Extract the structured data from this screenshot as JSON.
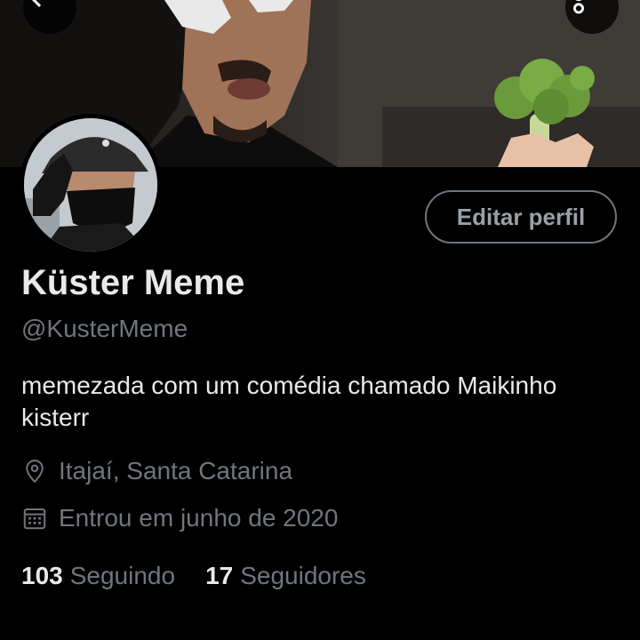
{
  "header": {
    "back_icon": "arrow-left-icon",
    "more_icon": "more-vertical-icon"
  },
  "profile": {
    "display_name": "Küster Meme",
    "handle": "@KusterMeme",
    "bio": "memezada com um comédia chamado Maikinho kisterr",
    "location": "Itajaí, Santa Catarina",
    "location_icon": "map-pin-icon",
    "joined": "Entrou em junho de 2020",
    "joined_icon": "calendar-icon",
    "edit_button_label": "Editar perfil"
  },
  "stats": {
    "following_count": "103",
    "following_label": "Seguindo",
    "followers_count": "17",
    "followers_label": "Seguidores"
  },
  "colors": {
    "background": "#000000",
    "text_primary": "#e7e9ea",
    "text_secondary": "#71767b",
    "button_border": "#6e767d"
  }
}
